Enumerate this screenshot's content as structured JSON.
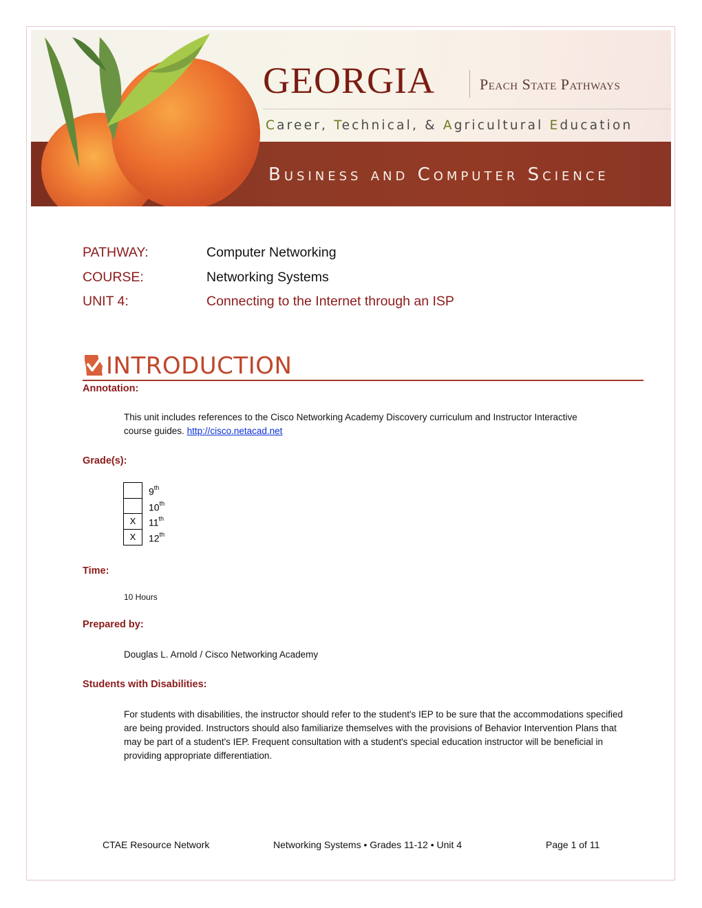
{
  "banner": {
    "georgia": "GEORGIA",
    "peach_state_pathways": "Peach State Pathways",
    "subtitle_parts": [
      {
        "first": "C",
        "rest": "areer, "
      },
      {
        "first": "T",
        "rest": "echnical, & "
      },
      {
        "first": "A",
        "rest": "gricultural "
      },
      {
        "first": "E",
        "rest": "ducation"
      }
    ],
    "department": "Business and Computer Science",
    "colors": {
      "maroon_band": "#8e3a26",
      "title_red": "#7a1c12"
    }
  },
  "header": {
    "pathway_label": "PATHWAY:",
    "pathway_value": "Computer Networking",
    "course_label": "COURSE:",
    "course_value": "Networking Systems",
    "unit_label": "UNIT 4:",
    "unit_value": "Connecting to the Internet through an ISP"
  },
  "introduction": {
    "title": "INTRODUCTION",
    "icon": "georgia-checkmark-icon",
    "annotation_label": "Annotation:",
    "annotation_text": "This unit includes references to the Cisco Networking Academy Discovery curriculum and Instructor Interactive course guides.",
    "annotation_link": "http://cisco.netacad.net",
    "grades_label": "Grade(s):",
    "grades": [
      {
        "num": "9",
        "suffix": "th",
        "mark": ""
      },
      {
        "num": "10",
        "suffix": "th",
        "mark": ""
      },
      {
        "num": "11",
        "suffix": "th",
        "mark": "X"
      },
      {
        "num": "12",
        "suffix": "th",
        "mark": "X"
      }
    ],
    "time_label": "Time:",
    "time_value": "10 Hours",
    "prepared_label": "Prepared by:",
    "prepared_value": "Douglas L. Arnold / Cisco Networking Academy",
    "disabilities_label": "Students with Disabilities:",
    "disabilities_text": "For students with disabilities, the instructor should refer to the student's IEP to be sure that the accommodations specified are being provided. Instructors should also familiarize themselves with the provisions of Behavior Intervention Plans that may be part of a student's IEP. Frequent consultation with a student's special education instructor will be beneficial in providing appropriate differentiation."
  },
  "footer": {
    "left": "CTAE Resource Network",
    "center": "Networking Systems • Grades 11-12 • Unit 4",
    "right": "Page 1 of 11"
  }
}
